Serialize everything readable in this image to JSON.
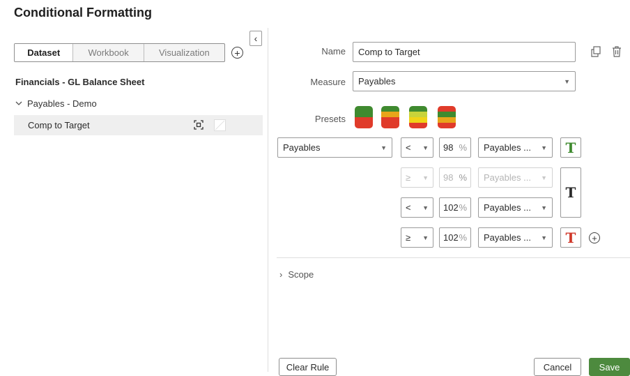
{
  "title": "Conditional Formatting",
  "tabs": [
    {
      "label": "Dataset"
    },
    {
      "label": "Workbook"
    },
    {
      "label": "Visualization"
    }
  ],
  "tree": {
    "dataset_name": "Financials - GL Balance Sheet",
    "group_label": "Payables - Demo",
    "rule_label": "Comp to Target"
  },
  "form": {
    "name_label": "Name",
    "name_value": "Comp to Target",
    "measure_label": "Measure",
    "measure_value": "Payables",
    "presets_label": "Presets"
  },
  "presets": [
    {
      "bands": [
        "#3f8a2f",
        "#3f8a2f",
        "#e03b2a",
        "#e03b2a"
      ]
    },
    {
      "bands": [
        "#3f8a2f",
        "#e8a51a",
        "#e03b2a",
        "#e03b2a"
      ]
    },
    {
      "bands": [
        "#3f8a2f",
        "#c8d33a",
        "#f0d317",
        "#e03b2a"
      ]
    },
    {
      "bands": [
        "#e03b2a",
        "#3f8a2f",
        "#e8a51a",
        "#e03b2a"
      ]
    }
  ],
  "rule": {
    "measure": "Payables",
    "conditions": [
      {
        "op": "<",
        "value": "98",
        "unit": "%",
        "target": "Payables ...",
        "disabled": false,
        "t_color": "#3f8a2f"
      },
      {
        "op": "≥",
        "value": "98",
        "unit": "%",
        "target": "Payables ...",
        "disabled": true
      },
      {
        "op": "<",
        "value": "102",
        "unit": "%",
        "target": "Payables ...",
        "disabled": false
      },
      {
        "op": "≥",
        "value": "102",
        "unit": "%",
        "target": "Payables ...",
        "disabled": false,
        "t_color": "#d0392b"
      }
    ],
    "middle_t_color": "#1f1f1f"
  },
  "scope_label": "Scope",
  "buttons": {
    "clear_rule": "Clear Rule",
    "cancel": "Cancel",
    "save": "Save"
  },
  "icons": {
    "collapse": "chevron-left-icon",
    "add_tab": "plus-circle-icon",
    "expand_group": "chevron-down-icon",
    "format": "format-select-icon",
    "copy": "copy-icon",
    "delete": "trash-icon",
    "add_rule": "plus-circle-icon",
    "scope": "chevron-right-icon"
  }
}
